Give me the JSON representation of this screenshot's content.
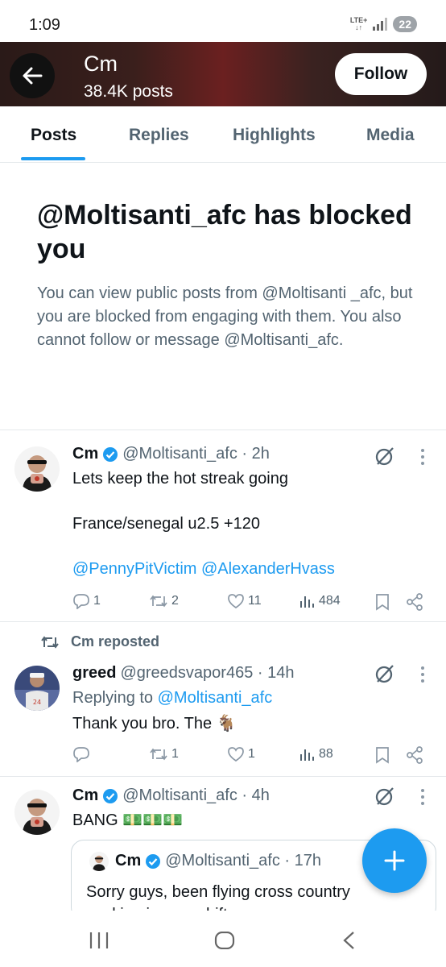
{
  "status_bar": {
    "time": "1:09",
    "network": "LTE+",
    "battery": "22"
  },
  "header": {
    "name": "Cm",
    "posts": "38.4K posts",
    "follow_label": "Follow"
  },
  "tabs": [
    "Posts",
    "Replies",
    "Highlights",
    "Media"
  ],
  "blocked": {
    "title": "@Moltisanti_afc has blocked you",
    "description": "You can view public posts from @Moltisanti _afc, but you are blocked from engaging with them. You also cannot follow or message @Moltisanti_afc."
  },
  "tweets": [
    {
      "name": "Cm",
      "handle": "@Moltisanti_afc · 2h",
      "line1": "Lets keep the hot streak going",
      "line2": "France/senegal u2.5 +120",
      "mention1": "@PennyPitVictim",
      "mention2": "@AlexanderHvass",
      "replies": "1",
      "reposts": "2",
      "likes": "11",
      "views": "484"
    },
    {
      "repost_label": "Cm reposted",
      "name": "greed",
      "handle": "@greedsvapor465 · 14h",
      "replying_prefix": "Replying to",
      "replying_handle": "@Moltisanti_afc",
      "text": "Thank you bro. The 🐐",
      "replies": "",
      "reposts": "1",
      "likes": "1",
      "views": "88"
    },
    {
      "name": "Cm",
      "handle": "@Moltisanti_afc · 4h",
      "text": "BANG 💵💵💵",
      "quote": {
        "name": "Cm",
        "handle": "@Moltisanti_afc · 17h",
        "text": "Sorry guys, been flying cross country working insane shifts"
      }
    }
  ],
  "icons": [
    "back-arrow-icon",
    "verified-icon",
    "grok-icon",
    "more-icon",
    "reply-icon",
    "repost-icon",
    "like-icon",
    "views-icon",
    "bookmark-icon",
    "share-icon",
    "compose-icon",
    "recents-icon",
    "home-icon",
    "back-icon"
  ],
  "colors": {
    "accent": "#1d9bf0",
    "text": "#0f1419",
    "muted": "#536471",
    "divider": "#e4e8eb"
  }
}
